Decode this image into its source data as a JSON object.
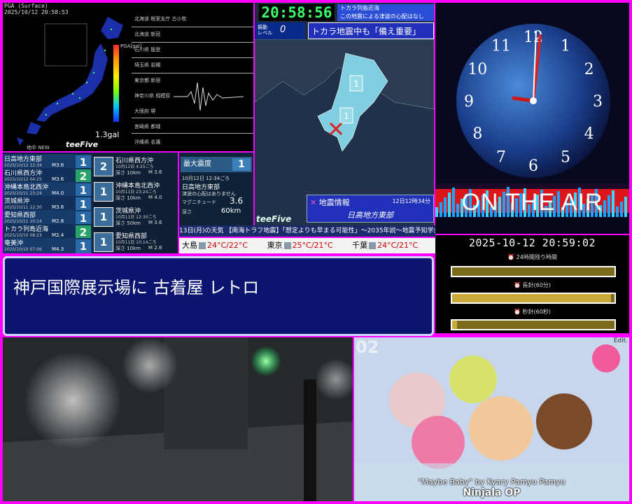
{
  "colors": {
    "frame": "#ff00ff",
    "onair_red": "#ff1a1a",
    "clock_green": "#3cff6a"
  },
  "seismic": {
    "header": [
      "PGA (Surface)",
      "2025/10/12 20:58:53"
    ],
    "legend_label": "PGA[gal]",
    "value": "1.3gal",
    "legend_note": "地中 NEW",
    "brand": "teeFive",
    "stations": [
      "北海道 根室支庁 古小牧",
      "北海道 新冠",
      "石川県 能登",
      "埼玉県 岩槻",
      "東京都 新宿",
      "神奈川県 相模原",
      "大阪府 堺",
      "宮崎県 都城",
      "沖縄県 名護"
    ]
  },
  "quake_list": [
    {
      "region": "日高地方東部",
      "time": "2025/10/12 12:34",
      "mag": "M3.6",
      "intensity": "1"
    },
    {
      "region": "石川県西方沖",
      "time": "2025/10/12 04:25",
      "mag": "M3.6",
      "intensity": "2"
    },
    {
      "region": "沖縄本島北西沖",
      "time": "2025/10/11 23:24",
      "mag": "M4.0",
      "intensity": "1"
    },
    {
      "region": "茨城県沖",
      "time": "2025/10/11 12:30",
      "mag": "M3.6",
      "intensity": "1"
    },
    {
      "region": "愛知県西部",
      "time": "2025/10/11 10:14",
      "mag": "M2.8",
      "intensity": "1"
    },
    {
      "region": "トカラ列島近海",
      "time": "2025/10/10 08:23",
      "mag": "M2.4",
      "intensity": "2"
    },
    {
      "region": "奄美沖",
      "time": "2025/10/10 07:06",
      "mag": "M4.3",
      "intensity": "1"
    }
  ],
  "recent": [
    {
      "intensity": "2",
      "region": "石川県西方沖",
      "time": "10月12日 4:25ごろ",
      "depth": "深さ 10km",
      "mag": "M 3.6"
    },
    {
      "intensity": "1",
      "region": "沖縄本島北西沖",
      "time": "10月11日 23:24ごろ",
      "depth": "深さ 10km",
      "mag": "M 4.0"
    },
    {
      "intensity": "1",
      "region": "茨城県沖",
      "time": "10月11日 12:30ごろ",
      "depth": "深さ 50km",
      "mag": "M 3.6"
    },
    {
      "intensity": "1",
      "region": "愛知県西部",
      "time": "10月11日 10:14ごろ",
      "depth": "深さ 10km",
      "mag": "M 2.8"
    }
  ],
  "max": {
    "title": "最大震度",
    "value": "1",
    "lines": [
      "10月12日 12:34ごろ",
      "日高地方東部",
      "津波の心配はありません",
      "マグニチュード",
      "深さ"
    ],
    "magnitude": "3.6",
    "depth": "60km"
  },
  "region": {
    "clock": "20:58:56",
    "tsunami_note": [
      "トカラ列島近海",
      "この地震による津波の心配はなし"
    ],
    "level_label": [
      "振動",
      "レベル"
    ],
    "level_value": "0",
    "alert": "トカラ地震中も「備え重要」",
    "info_title": "地震情報",
    "info_time": "12日12時34分",
    "info_region": "日高地方東部",
    "brand": "teeFive",
    "markers": [
      "1",
      "1"
    ]
  },
  "ticker": "13日(月)の天気 【南海トラフ地震】「想定よりも早まる可能性」～2035年説～地震予知学会",
  "weather": [
    {
      "city": "大島",
      "temp": "24°C/22°C"
    },
    {
      "city": "東京",
      "temp": "25°C/21°C"
    },
    {
      "city": "千葉",
      "temp": "24°C/21°C"
    }
  ],
  "now_playing": "神戸国際展示場に 古着屋 レトロ",
  "clock": {
    "numbers": [
      "12",
      "1",
      "2",
      "3",
      "4",
      "5",
      "6",
      "7",
      "8",
      "9",
      "10",
      "11"
    ],
    "onair": "ON THE AIR"
  },
  "timers": {
    "datetime": "2025-10-12 20:59:02",
    "items": [
      {
        "label": "⏰ 24時間残り時間",
        "fraction": 0.0
      },
      {
        "label": "⏰ 長針(60分)",
        "fraction": 0.98
      },
      {
        "label": "⏰ 秒針(60秒)",
        "fraction": 0.03
      }
    ]
  },
  "anime": {
    "num": "02",
    "edit": "Edit.",
    "song": "\"Maybe Baby\" by Kyary Pamyu Pamyu",
    "title": "Ninjala OP"
  }
}
